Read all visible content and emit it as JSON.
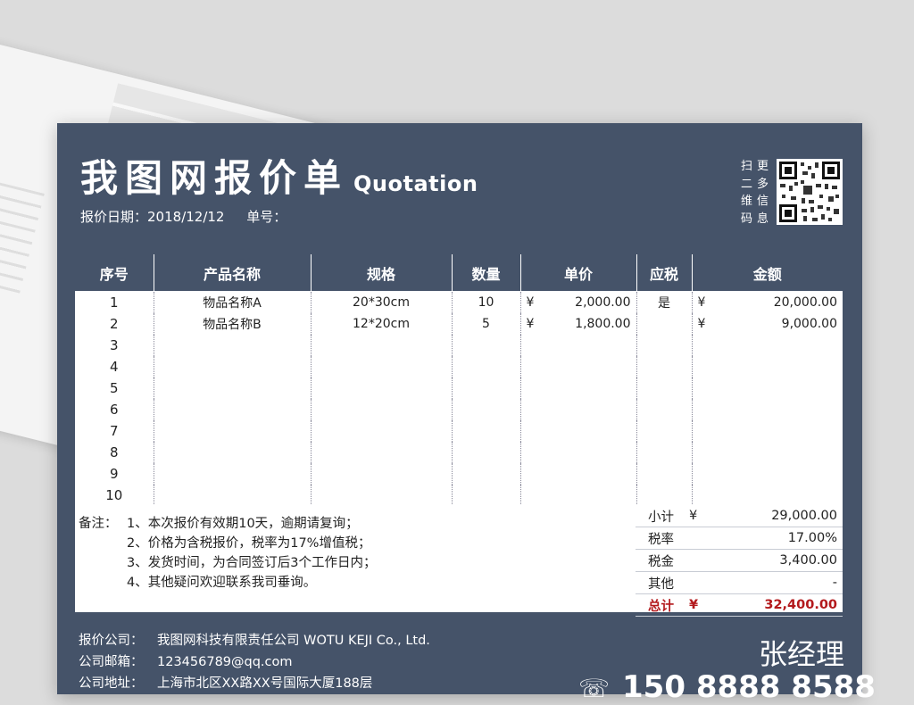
{
  "header": {
    "title_cn": "我图网报价单",
    "title_en": "Quotation",
    "date_label": "报价日期：",
    "date_value": "2018/12/12",
    "number_label": "单号："
  },
  "qr": {
    "caption": [
      "扫",
      "更",
      "二",
      "多",
      "维",
      "信",
      "码",
      "息"
    ],
    "icon": "qr-code-icon"
  },
  "table": {
    "headers": [
      "序号",
      "产品名称",
      "规格",
      "数量",
      "单价",
      "应税",
      "金额"
    ],
    "currency_symbol": "¥",
    "rows": [
      {
        "no": "1",
        "name": "物品名称A",
        "spec": "20*30cm",
        "qty": "10",
        "price": "2,000.00",
        "taxable": "是",
        "amount": "20,000.00"
      },
      {
        "no": "2",
        "name": "物品名称B",
        "spec": "12*20cm",
        "qty": "5",
        "price": "1,800.00",
        "taxable": "",
        "amount": "9,000.00"
      },
      {
        "no": "3",
        "name": "",
        "spec": "",
        "qty": "",
        "price": "",
        "taxable": "",
        "amount": ""
      },
      {
        "no": "4",
        "name": "",
        "spec": "",
        "qty": "",
        "price": "",
        "taxable": "",
        "amount": ""
      },
      {
        "no": "5",
        "name": "",
        "spec": "",
        "qty": "",
        "price": "",
        "taxable": "",
        "amount": ""
      },
      {
        "no": "6",
        "name": "",
        "spec": "",
        "qty": "",
        "price": "",
        "taxable": "",
        "amount": ""
      },
      {
        "no": "7",
        "name": "",
        "spec": "",
        "qty": "",
        "price": "",
        "taxable": "",
        "amount": ""
      },
      {
        "no": "8",
        "name": "",
        "spec": "",
        "qty": "",
        "price": "",
        "taxable": "",
        "amount": ""
      },
      {
        "no": "9",
        "name": "",
        "spec": "",
        "qty": "",
        "price": "",
        "taxable": "",
        "amount": ""
      },
      {
        "no": "10",
        "name": "",
        "spec": "",
        "qty": "",
        "price": "",
        "taxable": "",
        "amount": ""
      }
    ]
  },
  "notes": {
    "label": "备注：",
    "items": [
      "1、本次报价有效期10天，逾期请复询；",
      "2、价格为含税报价，税率为17%增值税；",
      "3、发货时间，为合同签订后3个工作日内；",
      "4、其他疑问欢迎联系我司垂询。"
    ]
  },
  "summary": {
    "subtotal_label": "小计",
    "subtotal_symbol": "¥",
    "subtotal_value": "29,000.00",
    "rate_label": "税率",
    "rate_value": "17.00%",
    "tax_label": "税金",
    "tax_value": "3,400.00",
    "other_label": "其他",
    "other_value": "-",
    "total_label": "总计",
    "total_symbol": "¥",
    "total_value": "32,400.00"
  },
  "footer": {
    "company_label": "报价公司：",
    "company_value": "我图网科技有限责任公司 WOTU  KEJI Co., Ltd.",
    "email_label": "公司邮箱：",
    "email_value": "123456789@qq.com",
    "address_label": "公司地址：",
    "address_value": "上海市北区XX路XX号国际大厦188层",
    "signer": "张经理",
    "phone": "150 8888 8588"
  },
  "colors": {
    "card_bg": "#455369",
    "total_red": "#b3191c"
  }
}
